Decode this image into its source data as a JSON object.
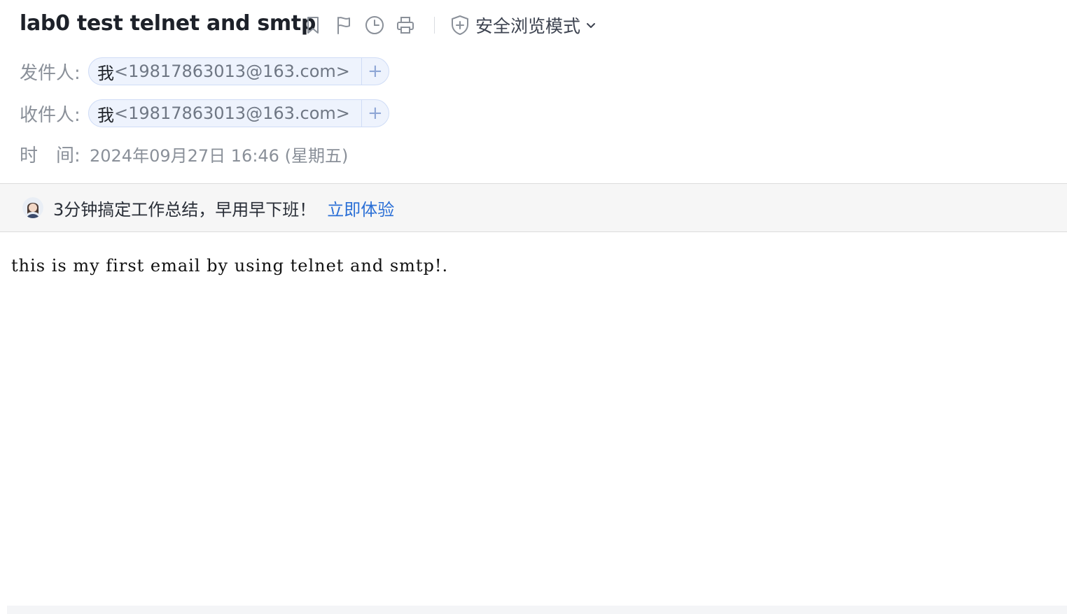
{
  "email": {
    "subject": "lab0 test telnet and smtp",
    "toolbar": {
      "icons": [
        "bookmark-icon",
        "flag-icon",
        "clock-icon",
        "print-icon"
      ],
      "safe_mode_label": "安全浏览模式"
    },
    "sender": {
      "label": "发件人:",
      "name": "我",
      "address": "<19817863013@163.com>",
      "add": "+"
    },
    "recipient": {
      "label": "收件人:",
      "name": "我",
      "address": "<19817863013@163.com>",
      "add": "+"
    },
    "time": {
      "label": "时　间:",
      "value": "2024年09月27日 16:46 (星期五)"
    },
    "promo": {
      "text": "3分钟搞定工作总结，早用早下班！",
      "link": "立即体验"
    },
    "body": "this is my first email by using telnet and smtp!."
  },
  "colors": {
    "accent": "#2a6fd6",
    "chip_bg": "#eef3fd",
    "chip_border": "#cfdcf6",
    "muted": "#8a9099"
  }
}
